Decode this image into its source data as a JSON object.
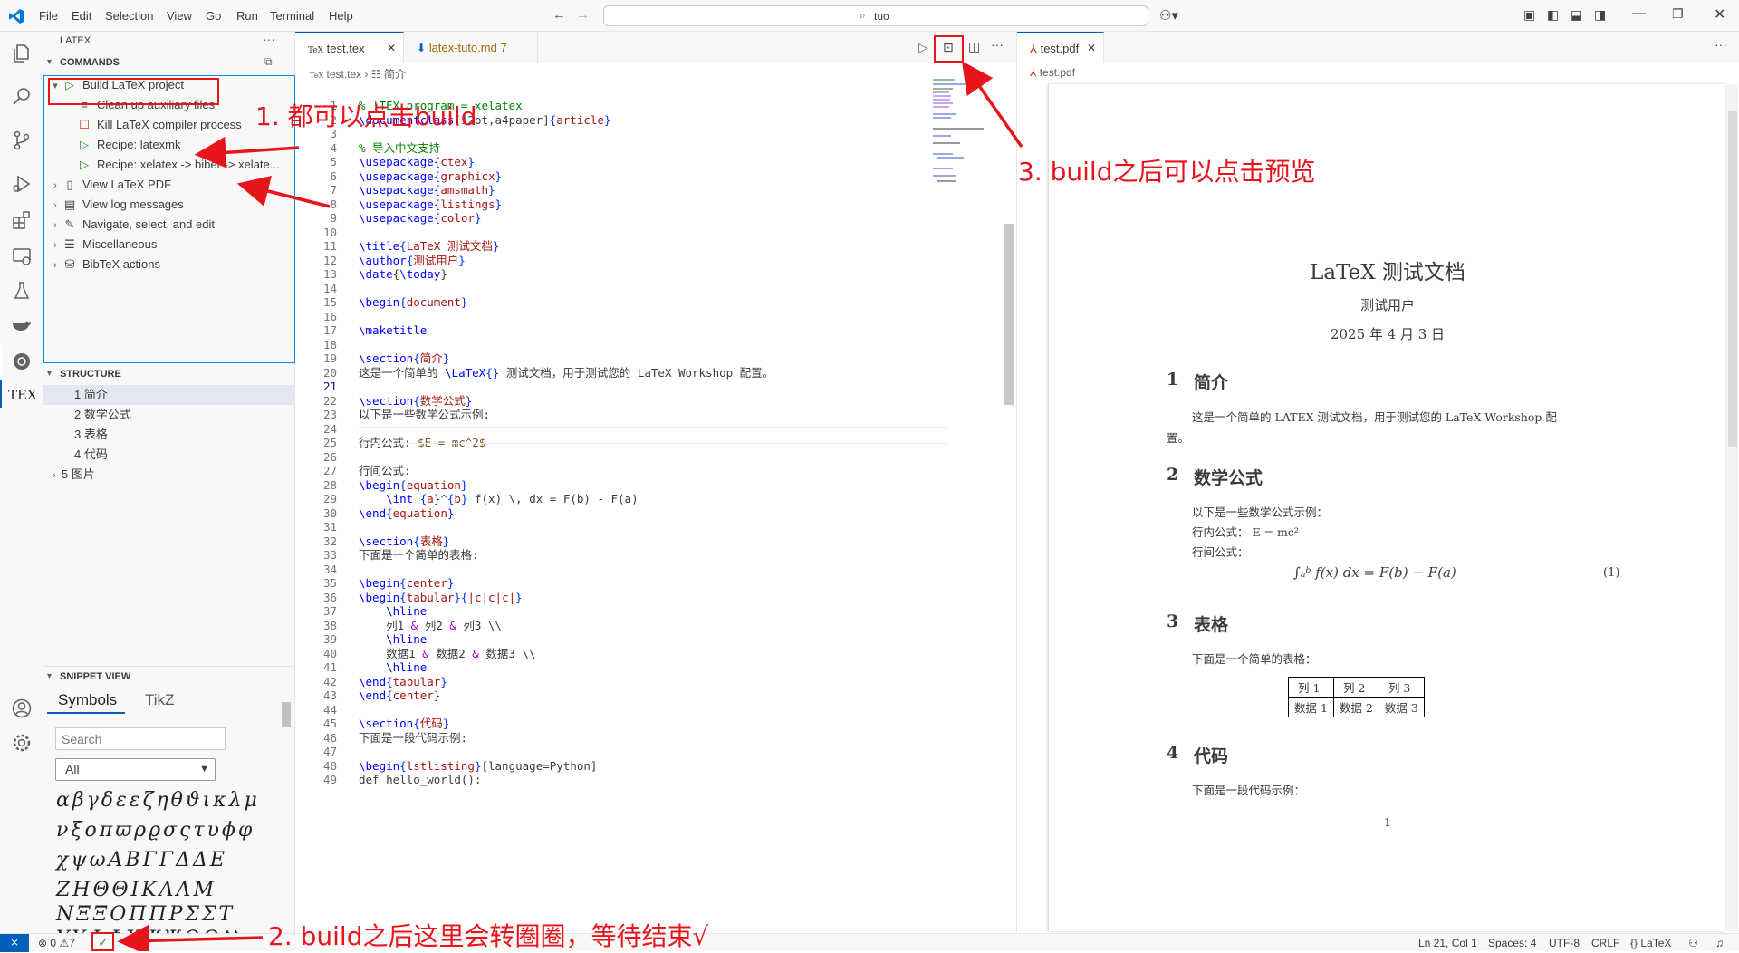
{
  "menu": [
    "File",
    "Edit",
    "Selection",
    "View",
    "Go",
    "Run",
    "Terminal",
    "Help"
  ],
  "search": {
    "value": "tuo"
  },
  "sidebar": {
    "title": "LATEX",
    "commands_header": "COMMANDS",
    "commands": [
      "Build LaTeX project",
      "Clean up auxiliary files",
      "Kill LaTeX compiler process",
      "Recipe: latexmk",
      "Recipe: xelatex -> biber -> xelate...",
      "View LaTeX PDF",
      "View log messages",
      "Navigate, select, and edit",
      "Miscellaneous",
      "BibTeX actions"
    ],
    "structure_header": "STRUCTURE",
    "structure": [
      "1 简介",
      "2 数学公式",
      "3 表格",
      "4 代码",
      "5 图片"
    ],
    "snippet_header": "SNIPPET VIEW",
    "snippet_tabs": [
      "Symbols",
      "TikZ"
    ],
    "snippet_search_placeholder": "Search",
    "snippet_select": "All",
    "symbol_rows": [
      "αβγδεεζηθϑικλμ",
      "νξοπϖρϱσςτυϕφ",
      "χψωΑΒΓΓΔΔΕ",
      "ΖΗΘΘΙΚΛΛΜ",
      "ΝΞΞΟΠΠΡΣΣΤ",
      "ΥΥΦΦΧΨΨΩΩℵ"
    ]
  },
  "editor": {
    "tabs": [
      {
        "label": "test.tex"
      },
      {
        "label": "latex-tuto.md",
        "badge": "7"
      }
    ],
    "breadcrumb": [
      "test.tex",
      "简介"
    ],
    "cursor_line": "21"
  },
  "code_lines": [
    [
      "1",
      "% !TEX program = xelatex"
    ],
    [
      "2",
      "\\documentclass[12pt,a4paper]{article}"
    ],
    [
      "3",
      ""
    ],
    [
      "4",
      "% 导入中文支持"
    ],
    [
      "5",
      "\\usepackage{ctex}"
    ],
    [
      "6",
      "\\usepackage{graphicx}"
    ],
    [
      "7",
      "\\usepackage{amsmath}"
    ],
    [
      "8",
      "\\usepackage{listings}"
    ],
    [
      "9",
      "\\usepackage{color}"
    ],
    [
      "10",
      ""
    ],
    [
      "11",
      "\\title{LaTeX 测试文档}"
    ],
    [
      "12",
      "\\author{测试用户}"
    ],
    [
      "13",
      "\\date{\\today}"
    ],
    [
      "14",
      ""
    ],
    [
      "15",
      "\\begin{document}"
    ],
    [
      "16",
      ""
    ],
    [
      "17",
      "\\maketitle"
    ],
    [
      "18",
      ""
    ],
    [
      "19",
      "\\section{简介}"
    ],
    [
      "20",
      "这是一个简单的 \\LaTeX{} 测试文档，用于测试您的 LaTeX Workshop 配置。"
    ],
    [
      "21",
      ""
    ],
    [
      "22",
      "\\section{数学公式}"
    ],
    [
      "23",
      "以下是一些数学公式示例:"
    ],
    [
      "24",
      ""
    ],
    [
      "25",
      "行内公式: $E = mc^2$"
    ],
    [
      "26",
      ""
    ],
    [
      "27",
      "行间公式:"
    ],
    [
      "28",
      "\\begin{equation}"
    ],
    [
      "29",
      "    \\int_{a}^{b} f(x) \\, dx = F(b) - F(a)"
    ],
    [
      "30",
      "\\end{equation}"
    ],
    [
      "31",
      ""
    ],
    [
      "32",
      "\\section{表格}"
    ],
    [
      "33",
      "下面是一个简单的表格:"
    ],
    [
      "34",
      ""
    ],
    [
      "35",
      "\\begin{center}"
    ],
    [
      "36",
      "\\begin{tabular}{|c|c|c|}"
    ],
    [
      "37",
      "    \\hline"
    ],
    [
      "38",
      "    列1 & 列2 & 列3 \\\\"
    ],
    [
      "39",
      "    \\hline"
    ],
    [
      "40",
      "    数据1 & 数据2 & 数据3 \\\\"
    ],
    [
      "41",
      "    \\hline"
    ],
    [
      "42",
      "\\end{tabular}"
    ],
    [
      "43",
      "\\end{center}"
    ],
    [
      "44",
      ""
    ],
    [
      "45",
      "\\section{代码}"
    ],
    [
      "46",
      "下面是一段代码示例:"
    ],
    [
      "47",
      ""
    ],
    [
      "48",
      "\\begin{lstlisting}[language=Python]"
    ],
    [
      "49",
      "def hello_world():"
    ]
  ],
  "pdf": {
    "tab": "test.pdf",
    "breadcrumb": "test.pdf",
    "title": "LaTeX 测试文档",
    "author": "测试用户",
    "date": "2025 年 4 月 3 日",
    "s1_num": "1",
    "s1": "简介",
    "s1_text": "这是一个简单的 LATEX 测试文档，用于测试您的 LaTeX Workshop 配",
    "s1_text2": "置。",
    "s2_num": "2",
    "s2": "数学公式",
    "s2_t1": "以下是一些数学公式示例：",
    "s2_t2": "行内公式： E = mc²",
    "s2_t3": "行间公式：",
    "equation": "∫ₐᵇ f(x) dx = F(b) − F(a)",
    "eq_num": "(1)",
    "s3_num": "3",
    "s3": "表格",
    "s3_t1": "下面是一个简单的表格：",
    "table": [
      [
        "列 1",
        "列 2",
        "列 3"
      ],
      [
        "数据 1",
        "数据 2",
        "数据 3"
      ]
    ],
    "s4_num": "4",
    "s4": "代码",
    "s4_t1": "下面是一段代码示例：",
    "page_num": "1"
  },
  "status": {
    "errors": "0",
    "warnings": "7",
    "position": "Ln 21, Col 1",
    "spaces": "Spaces: 4",
    "encoding": "UTF-8",
    "eol": "CRLF",
    "language": "LaTeX"
  },
  "annotations": [
    "1. 都可以点击build",
    "2. build之后这里会转圈圈，等待结束√",
    "3. build之后可以点击预览"
  ]
}
